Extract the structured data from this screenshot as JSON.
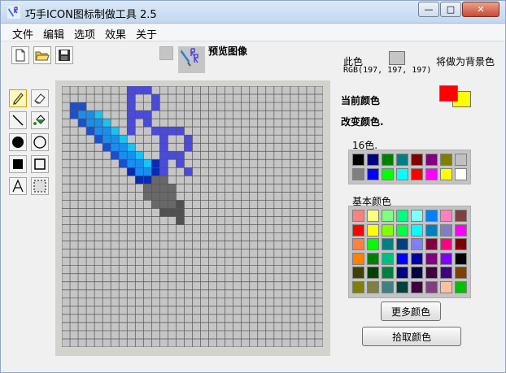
{
  "window": {
    "title": "巧手ICON图标制做工具 2.5",
    "buttons": {
      "minimize": "—",
      "maximize": "□",
      "close": "✕"
    }
  },
  "menu": [
    "文件",
    "编辑",
    "选项",
    "效果",
    "关于"
  ],
  "toolbar": {
    "icons": [
      "new-file-icon",
      "open-folder-icon",
      "save-icon"
    ]
  },
  "preview": {
    "label": "预览图像"
  },
  "tools": [
    "pencil",
    "eraser",
    "line",
    "fill",
    "filled-circle",
    "circle",
    "filled-rect",
    "rect",
    "text",
    "select"
  ],
  "color_info": {
    "label": "此色",
    "rgb_text": "RGB(197, 197, 197)",
    "set_bg_label": "将做为背景色",
    "sample_color": "#c5c5c5"
  },
  "current_color": {
    "label": "当前颜色",
    "fg": "#ff0000",
    "bg": "#ffff00"
  },
  "change_color_label": "改变颜色.",
  "palette16": {
    "label": "16色.",
    "colors": [
      "#000000",
      "#000080",
      "#008000",
      "#008080",
      "#800000",
      "#800080",
      "#808000",
      "#c0c0c0",
      "#808080",
      "#0000ff",
      "#00ff00",
      "#00ffff",
      "#ff0000",
      "#ff00ff",
      "#ffff00",
      "#ffffff"
    ]
  },
  "basic_palette": {
    "label": "基本颜色",
    "colors": [
      "#ff8080",
      "#ffff80",
      "#80ff80",
      "#00ff80",
      "#80ffff",
      "#0080ff",
      "#ff80c0",
      "#804040",
      "#ff0000",
      "#ffff00",
      "#80ff00",
      "#00ff40",
      "#00ffff",
      "#0080c0",
      "#8080c0",
      "#ff00ff",
      "#ff8040",
      "#00ff00",
      "#008080",
      "#004080",
      "#8080ff",
      "#800040",
      "#ff0080",
      "#800000",
      "#ff8000",
      "#008000",
      "#00c080",
      "#0000ff",
      "#0000a0",
      "#800080",
      "#8000ff",
      "#000000",
      "#404000",
      "#004000",
      "#008040",
      "#000080",
      "#000040",
      "#400040",
      "#400080",
      "#804000",
      "#808000",
      "#808040",
      "#408080",
      "#004040",
      "#400040",
      "#804080",
      "#ffc0a0",
      "#00c000"
    ]
  },
  "buttons": {
    "more_colors": "更多颜色",
    "pick_color": "拾取颜色"
  },
  "canvas": {
    "grid_size": 32,
    "background": "#c5c5c5",
    "grid_line_color": "#555555",
    "pixels": {
      "#4a4adc": [
        [
          8,
          0
        ],
        [
          9,
          0
        ],
        [
          10,
          0
        ],
        [
          8,
          1
        ],
        [
          11,
          1
        ],
        [
          8,
          2
        ],
        [
          11,
          2
        ],
        [
          8,
          3
        ],
        [
          9,
          3
        ],
        [
          10,
          3
        ],
        [
          8,
          4
        ],
        [
          10,
          4
        ],
        [
          8,
          5
        ],
        [
          11,
          5
        ],
        [
          12,
          5
        ],
        [
          13,
          5
        ],
        [
          14,
          5
        ],
        [
          12,
          6
        ],
        [
          15,
          6
        ],
        [
          12,
          7
        ],
        [
          15,
          7
        ],
        [
          12,
          8
        ],
        [
          13,
          8
        ],
        [
          14,
          8
        ],
        [
          12,
          9
        ],
        [
          14,
          9
        ],
        [
          12,
          10
        ],
        [
          15,
          10
        ]
      ],
      "#1b4fd0": [
        [
          1,
          2
        ],
        [
          2,
          2
        ],
        [
          1,
          3
        ],
        [
          2,
          4
        ],
        [
          3,
          5
        ],
        [
          4,
          6
        ],
        [
          5,
          7
        ],
        [
          6,
          8
        ],
        [
          7,
          9
        ]
      ],
      "#1a8ef0": [
        [
          2,
          3
        ],
        [
          3,
          3
        ],
        [
          3,
          4
        ],
        [
          4,
          4
        ],
        [
          4,
          5
        ],
        [
          5,
          5
        ],
        [
          5,
          6
        ],
        [
          6,
          6
        ],
        [
          6,
          7
        ],
        [
          7,
          7
        ],
        [
          7,
          8
        ],
        [
          8,
          8
        ],
        [
          8,
          9
        ],
        [
          9,
          9
        ],
        [
          9,
          10
        ],
        [
          10,
          10
        ]
      ],
      "#17c3f5": [
        [
          4,
          3
        ],
        [
          5,
          4
        ],
        [
          6,
          5
        ],
        [
          7,
          6
        ],
        [
          8,
          7
        ],
        [
          9,
          8
        ],
        [
          10,
          9
        ]
      ],
      "#0a2bb0": [
        [
          8,
          10
        ],
        [
          9,
          11
        ],
        [
          10,
          11
        ],
        [
          11,
          10
        ],
        [
          11,
          9
        ]
      ],
      "#686868": [
        [
          10,
          12
        ],
        [
          11,
          12
        ],
        [
          11,
          11
        ],
        [
          12,
          11
        ],
        [
          10,
          13
        ],
        [
          11,
          13
        ],
        [
          12,
          13
        ],
        [
          12,
          12
        ],
        [
          13,
          12
        ],
        [
          11,
          14
        ],
        [
          12,
          14
        ],
        [
          13,
          14
        ],
        [
          13,
          13
        ]
      ],
      "#505050": [
        [
          12,
          15
        ],
        [
          13,
          15
        ],
        [
          14,
          15
        ],
        [
          14,
          14
        ],
        [
          14,
          16
        ]
      ]
    }
  }
}
